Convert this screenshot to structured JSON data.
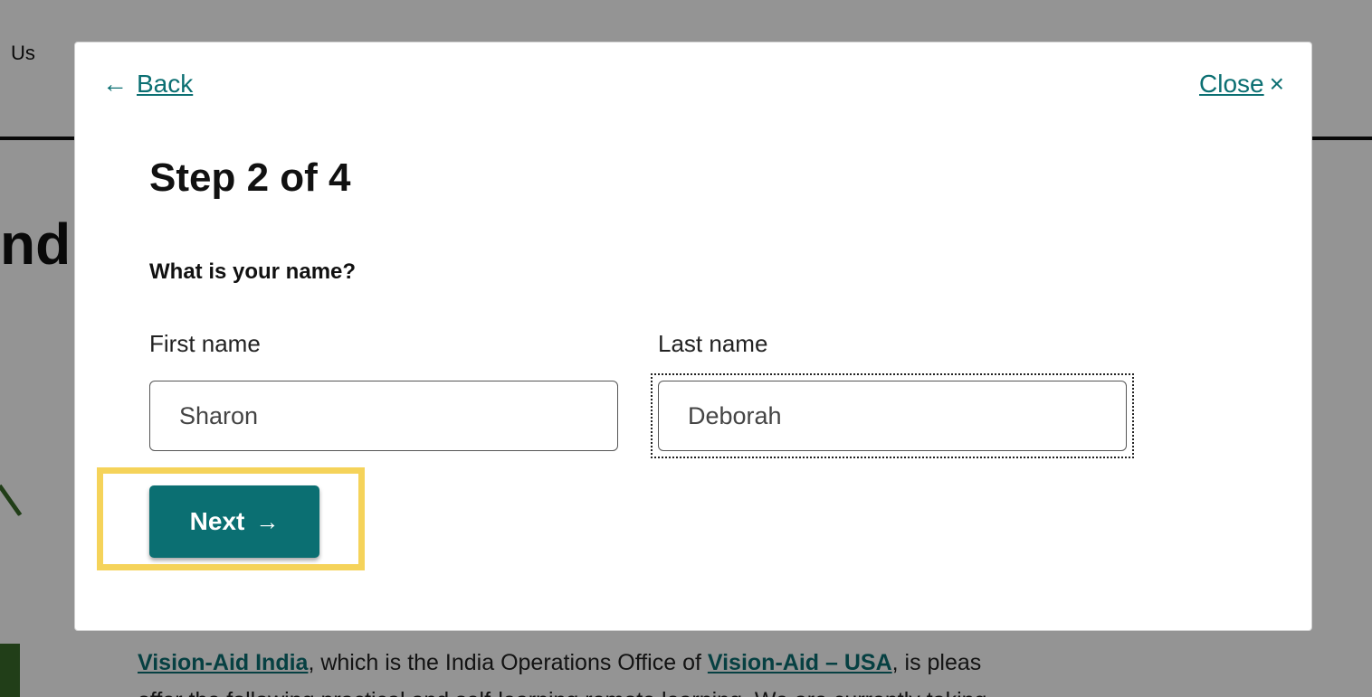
{
  "background": {
    "nav_text": "Us",
    "heading_fragment": "nd",
    "paragraph": {
      "link_1": "Vision-Aid India",
      "text_1": ", which is the India Operations Office of ",
      "link_2": "Vision-Aid – USA",
      "text_2": ", is pleas"
    },
    "paragraph_line_2": "offer the following practical and self-learning remote learning. We are currently taking"
  },
  "modal": {
    "back_arrow": "←",
    "back_label": "Back",
    "close_label": "Close",
    "close_icon": "×",
    "step_title": "Step 2 of 4",
    "question": "What is your name?",
    "first_name": {
      "label": "First name",
      "value": "Sharon"
    },
    "last_name": {
      "label": "Last name",
      "value": "Deborah"
    },
    "next_label": "Next",
    "next_arrow": "→"
  },
  "colors": {
    "accent": "#0b6f72",
    "highlight": "#f5d35a",
    "leaf_green": "#3a6b2a"
  },
  "icons": {
    "back": "arrow-left-icon",
    "close": "close-icon",
    "next": "arrow-right-icon"
  }
}
